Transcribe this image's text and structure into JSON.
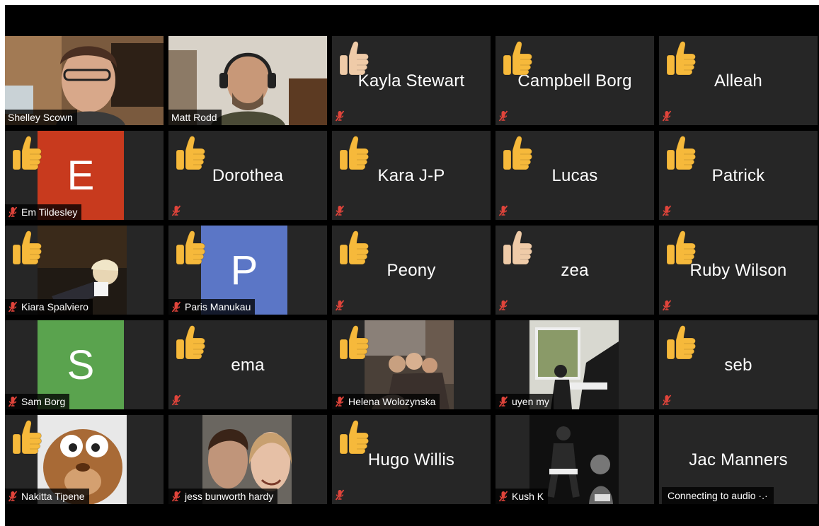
{
  "colors": {
    "tile_bg": "#262626",
    "active_speaker_border": "#b7e07a",
    "muted_icon": "#e0443b",
    "thumb_yellow": "#f6b93b",
    "thumb_light": "#efcba8",
    "avatar_red": "#c83a1e",
    "avatar_blue": "#5b76c6",
    "avatar_green": "#5aa34e"
  },
  "tiles": [
    {
      "name": "Shelley Scown",
      "kind": "video",
      "active_speaker": true
    },
    {
      "name": "Matt Rodd",
      "kind": "video"
    },
    {
      "name": "Kayla Stewart",
      "kind": "name",
      "reaction": "thumbs-up-light",
      "muted": true
    },
    {
      "name": "Campbell Borg",
      "kind": "name",
      "reaction": "thumbs-up-yellow",
      "muted": true
    },
    {
      "name": "Alleah",
      "kind": "name",
      "reaction": "thumbs-up-yellow",
      "muted": true
    },
    {
      "name": "Em Tildesley",
      "kind": "avatar",
      "initial": "E",
      "avatar_color": "red",
      "reaction": "thumbs-up-yellow",
      "muted": true
    },
    {
      "name": "Dorothea",
      "kind": "name",
      "reaction": "thumbs-up-yellow",
      "muted": true
    },
    {
      "name": "Kara J-P",
      "kind": "name",
      "reaction": "thumbs-up-yellow",
      "muted": true
    },
    {
      "name": "Lucas",
      "kind": "name",
      "reaction": "thumbs-up-yellow",
      "muted": true
    },
    {
      "name": "Patrick",
      "kind": "name",
      "reaction": "thumbs-up-yellow",
      "muted": true
    },
    {
      "name": "Kiara Spalviero",
      "kind": "photo",
      "reaction": "thumbs-up-yellow",
      "muted": true
    },
    {
      "name": "Paris Manukau",
      "kind": "avatar",
      "initial": "P",
      "avatar_color": "blue",
      "reaction": "thumbs-up-yellow",
      "muted": true
    },
    {
      "name": "Peony",
      "kind": "name",
      "reaction": "thumbs-up-yellow",
      "muted": true
    },
    {
      "name": "zea",
      "kind": "name",
      "reaction": "thumbs-up-light",
      "muted": true
    },
    {
      "name": "Ruby Wilson",
      "kind": "name",
      "reaction": "thumbs-up-yellow",
      "muted": true
    },
    {
      "name": "Sam Borg",
      "kind": "avatar",
      "initial": "S",
      "avatar_color": "green",
      "muted": true
    },
    {
      "name": "ema",
      "kind": "name",
      "reaction": "thumbs-up-yellow",
      "muted": true
    },
    {
      "name": "Helena Wolozynska",
      "kind": "photo",
      "reaction": "thumbs-up-yellow",
      "muted": true
    },
    {
      "name": "uyen my",
      "kind": "photo",
      "muted": true
    },
    {
      "name": "seb",
      "kind": "name",
      "reaction": "thumbs-up-yellow",
      "muted": true
    },
    {
      "name": "Nakitta Tipene",
      "kind": "photo",
      "reaction": "thumbs-up-yellow",
      "muted": true
    },
    {
      "name": "jess bunworth hardy",
      "kind": "photo",
      "muted": true
    },
    {
      "name": "Hugo Willis",
      "kind": "name",
      "reaction": "thumbs-up-yellow",
      "muted": true
    },
    {
      "name": "Kush K",
      "kind": "photo",
      "muted": true
    },
    {
      "name": "Jac Manners",
      "kind": "name",
      "status": "Connecting to audio ·.·"
    }
  ]
}
